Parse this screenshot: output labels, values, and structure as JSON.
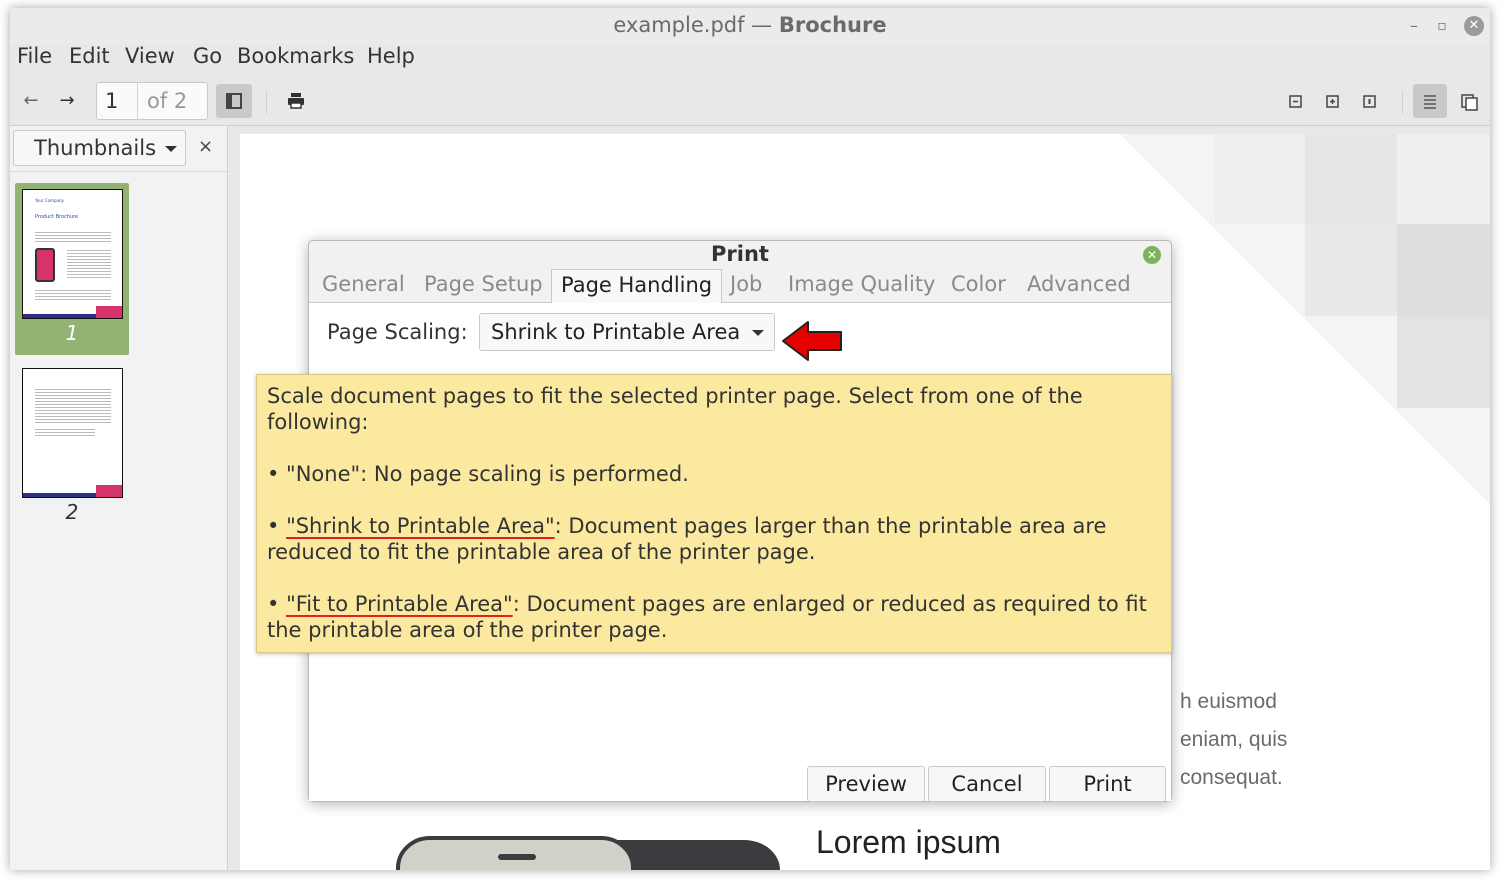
{
  "window": {
    "title_file": "example.pdf",
    "title_sep": " — ",
    "title_name": "Brochure",
    "minimize": "–",
    "maximize": "▫",
    "close": "✕"
  },
  "menu": [
    "File",
    "Edit",
    "View",
    "Go",
    "Bookmarks",
    "Help"
  ],
  "toolbar": {
    "page_current": "1",
    "page_of": "of 2"
  },
  "sidebar": {
    "combo_label": "Thumbnails",
    "close": "×",
    "thumbs": [
      "1",
      "2"
    ],
    "thumb1_title": "Your Company",
    "thumb1_heading": "Product Brochure"
  },
  "document": {
    "line1": "h euismod",
    "line2": "eniam, quis",
    "line3": "consequat.",
    "heading": "Lorem ipsum"
  },
  "dialog": {
    "title": "Print",
    "close": "✕",
    "tabs": [
      "General",
      "Page Setup",
      "Page Handling",
      "Job",
      "Image Quality",
      "Color",
      "Advanced"
    ],
    "active_tab": "Page Handling",
    "page_scaling_label": "Page Scaling:",
    "page_scaling_value": "Shrink to Printable Area",
    "buttons": {
      "preview": "Preview",
      "cancel": "Cancel",
      "print": "Print"
    }
  },
  "tooltip": {
    "intro": "Scale document pages to fit the selected printer page. Select from one of the following:",
    "none_bullet": "• \"None\": No page scaling is performed.",
    "bullet": "• ",
    "shrink_name": "\"Shrink to Printable Area\"",
    "shrink_desc": ": Document pages larger than the printable area are reduced to fit the printable area of the printer page.",
    "fit_name": "\"Fit to Printable Area\"",
    "fit_desc": ": Document pages are enlarged or reduced as required to fit the printable area of the printer page."
  },
  "colors": {
    "thumbnail_selected": "#93b374",
    "tooltip_bg": "#fce9a0",
    "annotation_red": "#e02020",
    "dialog_close": "#7cb45a"
  }
}
